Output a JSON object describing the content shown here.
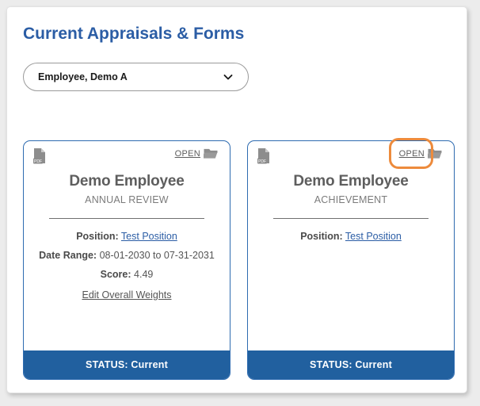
{
  "page": {
    "title": "Current Appraisals & Forms"
  },
  "employee_select": {
    "value": "Employee, Demo A",
    "chevron_icon": "chevron-down-icon"
  },
  "colors": {
    "title_blue": "#2b5da5",
    "footer_blue": "#21609f",
    "card_border_blue": "#2e6bb0",
    "highlight_orange": "#ed8b3c",
    "link_blue": "#2b5da5"
  },
  "cards": [
    {
      "doc_icon": "pdf-file-icon",
      "open_label": "OPEN",
      "folder_icon": "open-folder-icon",
      "highlighted": false,
      "name": "Demo Employee",
      "subtitle": "ANNUAL REVIEW",
      "fields": [
        {
          "label": "Position:",
          "value": "Test Position",
          "is_link": true
        },
        {
          "label": "Date Range:",
          "value": "08-01-2030 to 07-31-2031",
          "is_link": false
        },
        {
          "label": "Score:",
          "value": "4.49",
          "is_link": false
        }
      ],
      "edit_link": "Edit Overall Weights",
      "status": "STATUS: Current"
    },
    {
      "doc_icon": "pdf-file-icon",
      "open_label": "OPEN",
      "folder_icon": "open-folder-icon",
      "highlighted": true,
      "name": "Demo Employee",
      "subtitle": "ACHIEVEMENT",
      "fields": [
        {
          "label": "Position:",
          "value": "Test Position",
          "is_link": true
        }
      ],
      "edit_link": "",
      "status": "STATUS: Current"
    }
  ]
}
